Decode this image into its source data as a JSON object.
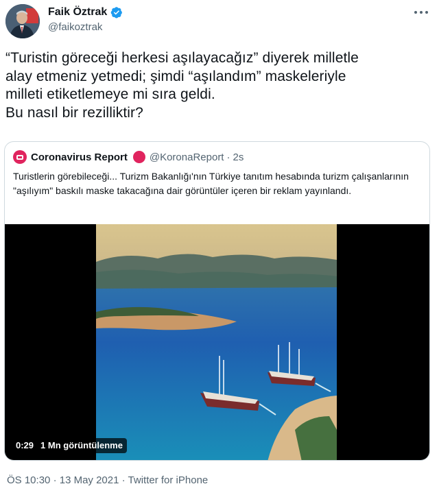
{
  "author": {
    "name": "Faik Öztrak",
    "handle": "@faikoztrak",
    "verified_color": "#1d9bf0"
  },
  "tweet": {
    "text": "“Turistin göreceği herkesi aşılayacağız” diyerek milletle\nalay etmeniz yetmedi; şimdi “aşılandım” maskeleriyle\nmilleti etiketlemeye mi sıra geldi.\nBu nasıl bir rezilliktir?"
  },
  "quoted": {
    "name": "Coronavirus Report",
    "handle": "@KoronaReport",
    "separator": "·",
    "time": "2s",
    "brand_color": "#e0245e",
    "text": "Turistlerin görebileceği... Turizm Bakanlığı'nın Türkiye tanıtım hesabında turizm çalışanlarının \"aşılıyım\" baskılı maske takacağına dair görüntüler içeren bir reklam yayınlandı.",
    "video": {
      "duration": "0:29",
      "views": "1 Mn görüntülenme"
    }
  },
  "meta": {
    "time": "ÖS 10:30",
    "dot1": "·",
    "date": "13 May 2021",
    "dot2": "·",
    "source": "Twitter for iPhone"
  },
  "icons": [
    "verified-badge-icon",
    "more-options-icon",
    "coronavirus-report-logo-icon"
  ]
}
